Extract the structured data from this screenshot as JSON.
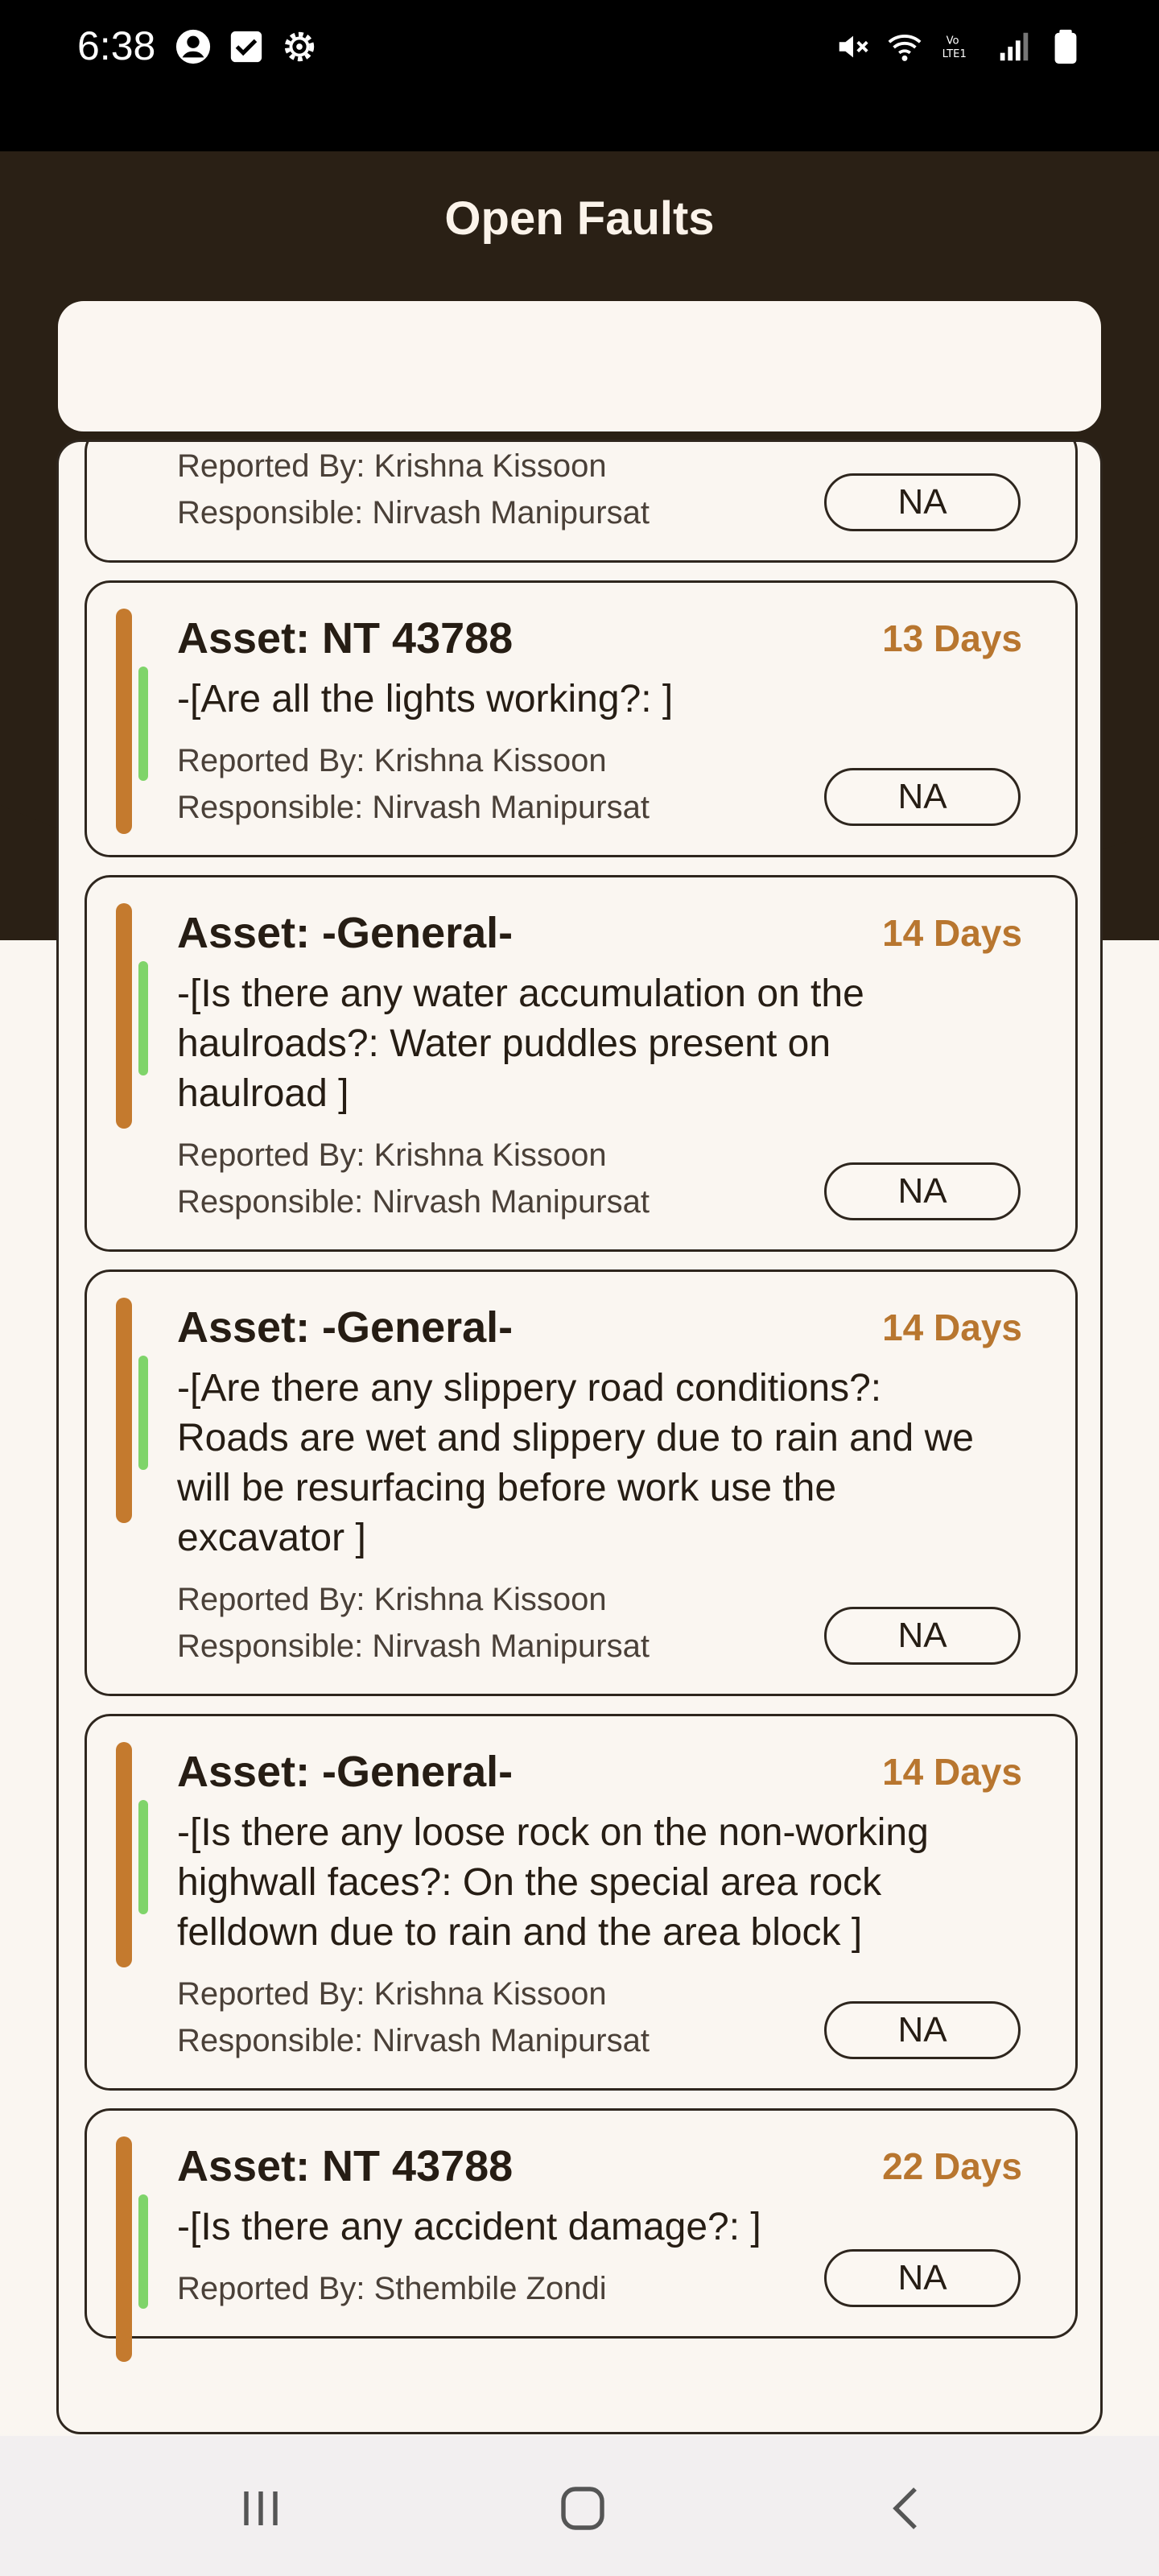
{
  "status_bar": {
    "time": "6:38",
    "left_icons": [
      "account-circle-icon",
      "checkbox-icon",
      "settings-gear-icon"
    ],
    "right_icons": [
      "mute-icon",
      "wifi-icon",
      "volte-lte-icon",
      "signal-icon",
      "battery-icon"
    ],
    "volte_label": "Vo LTE1"
  },
  "header": {
    "title": "Open Faults",
    "background_color": "#2a2015"
  },
  "search": {
    "value": ""
  },
  "colors": {
    "accent_orange": "#c47a2e",
    "days_text": "#b8762f",
    "status_green": "#7fd46a",
    "card_bg": "#faf6f1"
  },
  "faults": [
    {
      "asset": "",
      "question": "",
      "reported_by": "Reported By: Krishna Kissoon",
      "responsible": "Responsible: Nirvash Manipursat",
      "days": "",
      "action": "NA",
      "partial": true
    },
    {
      "asset": "Asset: NT 43788",
      "question": "-[Are all the lights working?: ]",
      "reported_by": "Reported By: Krishna Kissoon",
      "responsible": "Responsible: Nirvash Manipursat",
      "days": "13 Days",
      "action": "NA"
    },
    {
      "asset": "Asset: -General-",
      "question": "-[Is there any water accumulation on the haulroads?: Water puddles present on haulroad ]",
      "reported_by": "Reported By: Krishna Kissoon",
      "responsible": "Responsible: Nirvash Manipursat",
      "days": "14 Days",
      "action": "NA"
    },
    {
      "asset": "Asset: -General-",
      "question": "-[Are there any slippery road conditions?: Roads are wet and slippery due to rain and we will be resurfacing before work use the excavator ]",
      "reported_by": "Reported By: Krishna Kissoon",
      "responsible": "Responsible: Nirvash Manipursat",
      "days": "14 Days",
      "action": "NA"
    },
    {
      "asset": "Asset: -General-",
      "question": "-[Is there any loose rock on the non-working highwall faces?: On the special area rock felldown due to rain and the area block ]",
      "reported_by": "Reported By: Krishna Kissoon",
      "responsible": "Responsible: Nirvash Manipursat",
      "days": "14 Days",
      "action": "NA"
    },
    {
      "asset": "Asset: NT 43788",
      "question": "-[Is there any accident damage?: ]",
      "reported_by": "Reported By: Sthembile Zondi",
      "responsible": "",
      "days": "22 Days",
      "action": "NA"
    }
  ],
  "nav": {
    "items": [
      "recent-apps-icon",
      "home-icon",
      "back-icon"
    ]
  }
}
